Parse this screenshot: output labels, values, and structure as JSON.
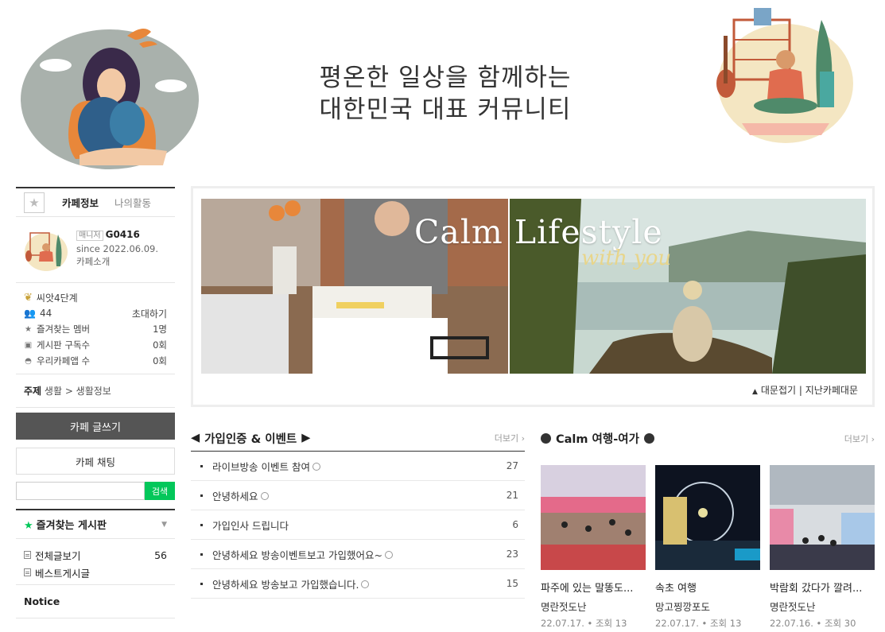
{
  "header": {
    "slogan_line1": "평온한 일상을 함께하는",
    "slogan_line2": "대한민국 대표 커뮤니티"
  },
  "sidebar": {
    "tabs": [
      "카페정보",
      "나의활동"
    ],
    "profile": {
      "manager_badge": "매니저",
      "name": "G0416",
      "since": "since 2022.06.09.",
      "intro": "카페소개"
    },
    "level": "씨앗4단계",
    "members": "44",
    "invite": "초대하기",
    "stats": [
      {
        "label": "즐겨찾는 멤버",
        "value": "1명"
      },
      {
        "label": "게시판 구독수",
        "value": "0회"
      },
      {
        "label": "우리카페앱 수",
        "value": "0회"
      }
    ],
    "topic_label": "주제",
    "topic_value": "생활 > 생활정보",
    "write_button": "카페 글쓰기",
    "chat_button": "카페 채팅",
    "search_button": "검색",
    "search_value": "",
    "favorites_title": "즐겨찾는 게시판",
    "boards": [
      {
        "label": "전체글보기",
        "count": "56"
      },
      {
        "label": "베스트게시글",
        "count": ""
      }
    ],
    "notice": "Notice"
  },
  "banner": {
    "title": "Calm Lifestyle",
    "subtitle": "with you",
    "fold": "대문접기",
    "separator": "|",
    "past": "지난카페대문"
  },
  "board_join": {
    "title": "가입인증 & 이벤트",
    "more": "더보기",
    "items": [
      {
        "title": "라이브방송 이벤트 참여",
        "count": "27"
      },
      {
        "title": "안녕하세요",
        "count": "21"
      },
      {
        "title": "가입인사 드립니다",
        "count": "6"
      },
      {
        "title": "안녕하세요 방송이벤트보고 가입했어요~",
        "count": "23"
      },
      {
        "title": "안녕하세요 방송보고 가입했습니다.",
        "count": "15"
      }
    ]
  },
  "board_travel": {
    "title": "Calm 여행-여가",
    "more": "더보기",
    "cards": [
      {
        "title": "파주에 있는 말똥도...",
        "writer": "명란젓도난",
        "meta": "22.07.17. • 조회 13"
      },
      {
        "title": "속초 여행",
        "writer": "망고찡깡포도",
        "meta": "22.07.17. • 조회 13"
      },
      {
        "title": "박람회 갔다가 깔려...",
        "writer": "명란젓도난",
        "meta": "22.07.16. • 조회 30"
      }
    ]
  }
}
